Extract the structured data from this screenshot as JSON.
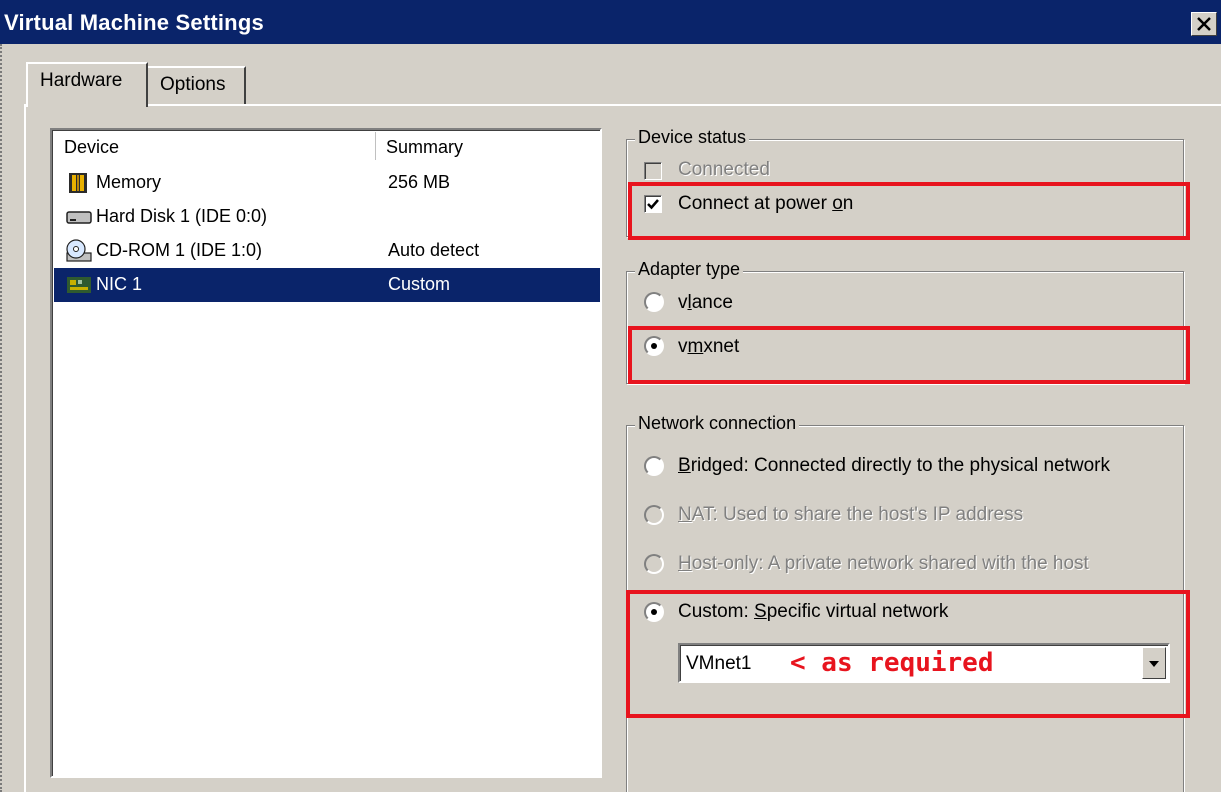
{
  "window": {
    "title": "Virtual Machine Settings"
  },
  "tabs": [
    {
      "label": "Hardware",
      "active": true
    },
    {
      "label": "Options",
      "active": false
    }
  ],
  "device_list": {
    "columns": [
      "Device",
      "Summary"
    ],
    "rows": [
      {
        "device": "Memory",
        "summary": "256 MB",
        "icon": "memory-icon"
      },
      {
        "device": "Hard Disk 1 (IDE 0:0)",
        "summary": "",
        "icon": "hard-disk-icon"
      },
      {
        "device": "CD-ROM 1 (IDE 1:0)",
        "summary": "Auto detect",
        "icon": "cdrom-icon"
      },
      {
        "device": "NIC 1",
        "summary": "Custom",
        "icon": "network-card-icon",
        "selected": true
      }
    ]
  },
  "device_status": {
    "title": "Device status",
    "connected_label": "Connected",
    "connect_power_pre": "Connect at power ",
    "connect_power_key": "o",
    "connect_power_post": "n"
  },
  "adapter_type": {
    "title": "Adapter type",
    "vlance_pre": "v",
    "vlance_key": "l",
    "vlance_post": "ance",
    "vmxnet_pre": "v",
    "vmxnet_key": "m",
    "vmxnet_post": "xnet"
  },
  "network_connection": {
    "title": "Network connection",
    "bridged_key": "B",
    "bridged_rest": "ridged: Connected directly to the physical network",
    "nat_key": "N",
    "nat_rest": "AT: Used to share the host's IP address",
    "hostonly_key": "H",
    "hostonly_rest": "ost-only: A private network shared with the host",
    "custom_pre": "Custom: ",
    "custom_key": "S",
    "custom_rest": "pecific virtual network",
    "selected_network": "VMnet1",
    "annotation": "< as required"
  },
  "colors": {
    "title_bar": "#0a246a",
    "dialog_bg": "#d4d0c8",
    "highlight_box": "#e8141e"
  }
}
